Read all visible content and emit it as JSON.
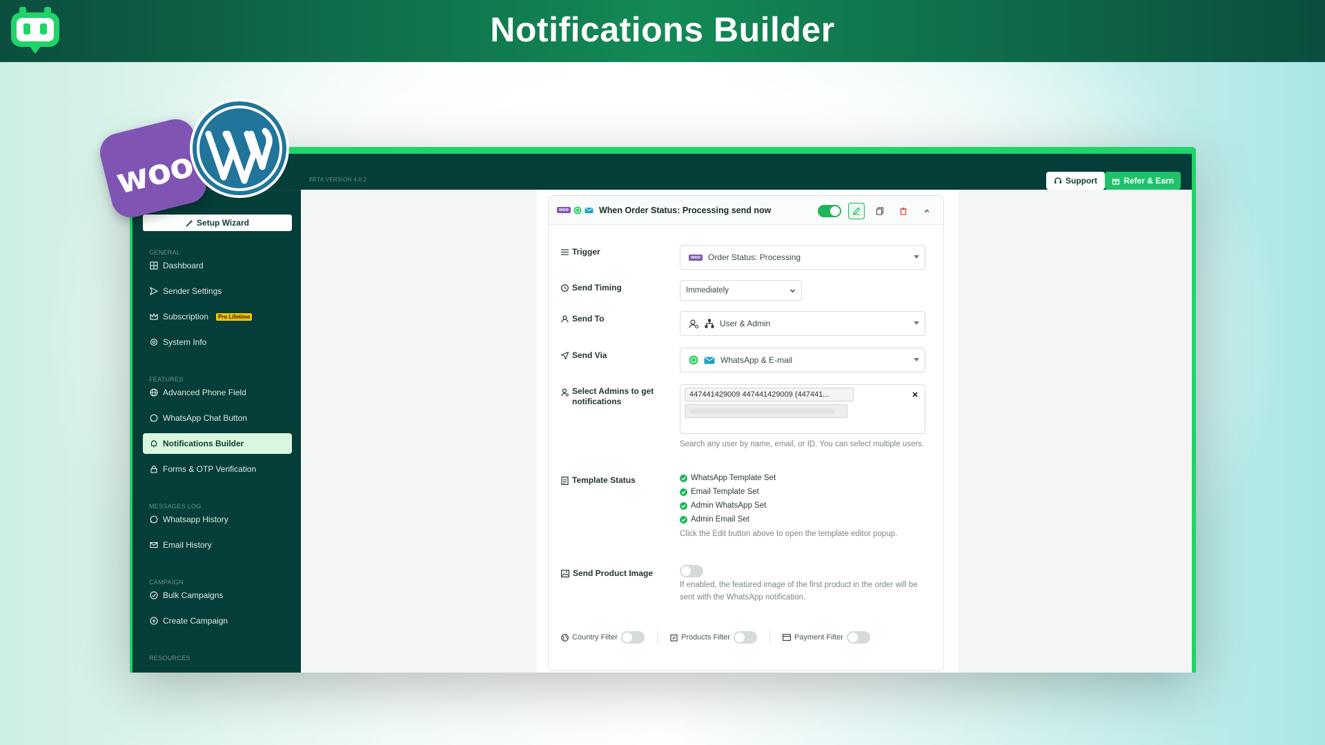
{
  "banner": {
    "title": "Notifications Builder"
  },
  "logos": {
    "woo_text": "woo"
  },
  "topbar": {
    "beta_label": "BETA VERSION 4.0.2",
    "support_label": "Support",
    "refer_label": "Refer & Earn"
  },
  "sidebar": {
    "setup_label": "Setup Wizard",
    "sections": {
      "general": "GENERAL",
      "features": "FEATURES",
      "messages_log": "MESSAGES LOG",
      "campaign": "CAMPAIGN",
      "resources": "RESOURCES"
    },
    "items": {
      "dashboard": "Dashboard",
      "sender": "Sender Settings",
      "subscription": "Subscription",
      "subscription_badge": "Pro Lifetime",
      "system": "System Info",
      "phone_field": "Advanced Phone Field",
      "chat_button": "WhatsApp Chat Button",
      "notifications": "Notifications Builder",
      "forms_otp": "Forms & OTP Verification",
      "wa_history": "Whatsapp History",
      "email_history": "Email History",
      "bulk": "Bulk Campaigns",
      "create": "Create Campaign"
    }
  },
  "card": {
    "title": "When Order Status: Processing send now",
    "enabled": true,
    "woo_badge": "woo",
    "rows": {
      "trigger_label": "Trigger",
      "trigger_value": "Order Status: Processing",
      "timing_label": "Send Timing",
      "timing_value": "Immediately",
      "send_to_label": "Send To",
      "send_to_value": "User & Admin",
      "send_via_label": "Send Via",
      "send_via_value": "WhatsApp & E-mail",
      "admins_label": "Select Admins to get notifications",
      "admin_chip_1": "447441429009 447441429009 (447441...",
      "admins_help": "Search any user by name, email, or ID. You can select multiple users.",
      "template_label": "Template Status",
      "template_items": [
        "WhatsApp Template Set",
        "Email Template Set",
        "Admin WhatsApp Set",
        "Admin Email Set"
      ],
      "template_help": "Click the Edit button above to open the template editor popup.",
      "image_label": "Send Product Image",
      "image_enabled": false,
      "image_help": "If enabled, the featured image of the first product in the order will be sent with the WhatsApp notification."
    },
    "filters": {
      "country": "Country Filter",
      "products": "Products Filter",
      "payment": "Payment Filter"
    }
  },
  "colors": {
    "brand_dark": "#053d38",
    "brand_green": "#1fd469",
    "active_bg": "#d9f7de",
    "toggle_on": "#1fb55d",
    "woo_purple": "#7f54b3",
    "wp_blue": "#21759b"
  }
}
